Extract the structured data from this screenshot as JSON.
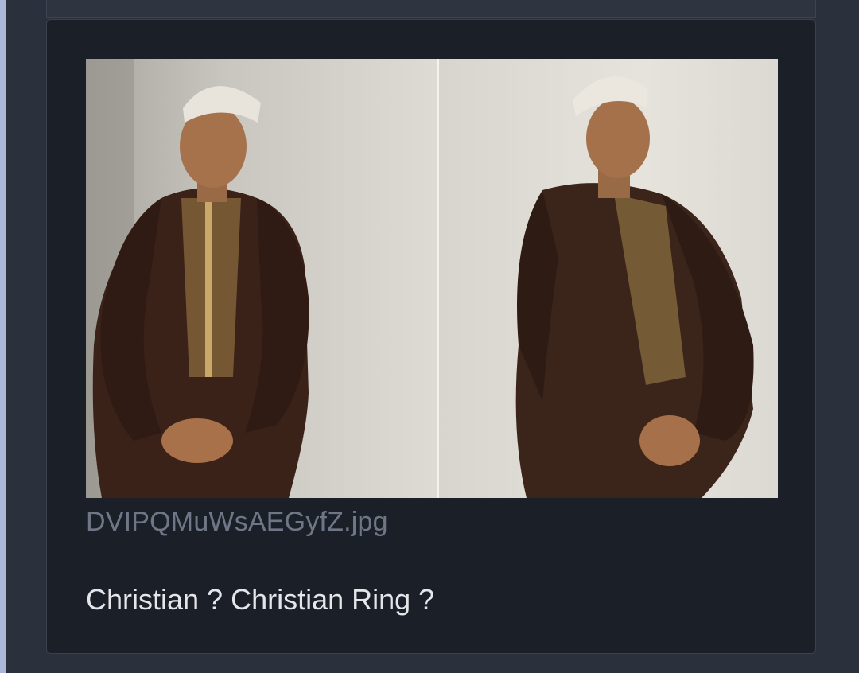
{
  "attachment": {
    "filename": "DVIPQMuWsAEGyfZ.jpg"
  },
  "post": {
    "text": "Christian ? Christian Ring ?"
  },
  "colors": {
    "page_background": "#2b313c",
    "card_background": "#1b1f27",
    "filename_text": "#6f7787",
    "body_text": "#e4e6ea"
  }
}
